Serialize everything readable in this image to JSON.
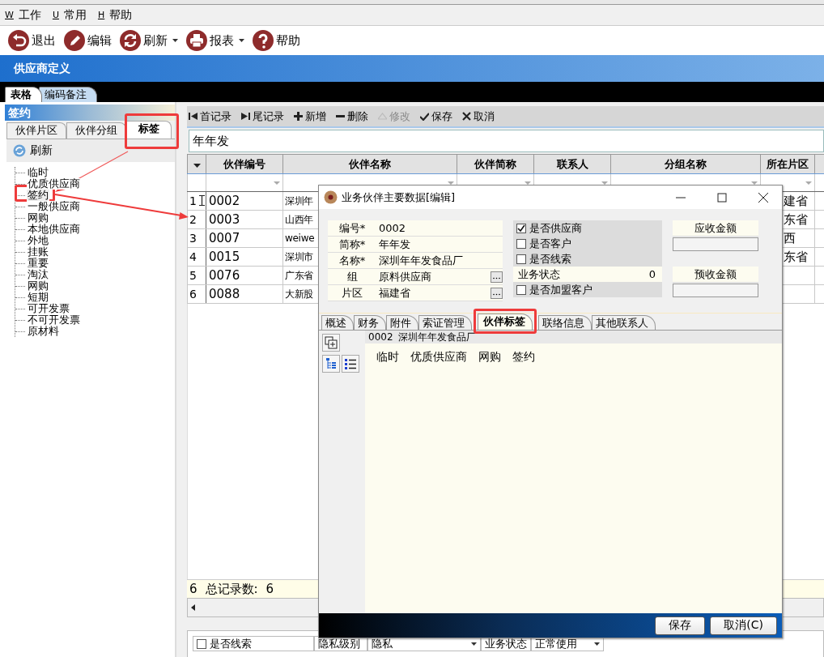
{
  "menu": [
    {
      "key": "W",
      "label": "工作"
    },
    {
      "key": "U",
      "label": "常用"
    },
    {
      "key": "H",
      "label": "帮助"
    }
  ],
  "toolbar": [
    {
      "kind": "exit",
      "label": "退出",
      "dropdown": false
    },
    {
      "kind": "edit",
      "label": "编辑",
      "dropdown": false
    },
    {
      "kind": "refresh",
      "label": "刷新",
      "dropdown": true
    },
    {
      "kind": "print",
      "label": "报表",
      "dropdown": true
    },
    {
      "kind": "help",
      "label": "帮助",
      "dropdown": false
    }
  ],
  "app_title": "供应商定义",
  "view_tabs": [
    {
      "label": "表格",
      "selected": true
    },
    {
      "label": "编码备注",
      "selected": false
    }
  ],
  "left_panel": {
    "title": "签约",
    "tabs": [
      {
        "label": "伙伴片区",
        "selected": false
      },
      {
        "label": "伙伴分组",
        "selected": false
      },
      {
        "label": "标签",
        "selected": true
      }
    ],
    "refresh": "刷新",
    "tree": [
      {
        "label": "临时",
        "selected": false
      },
      {
        "label": "优质供应商",
        "selected": false
      },
      {
        "label": "签约",
        "selected": true
      },
      {
        "label": "一般供应商",
        "selected": false
      },
      {
        "label": "网购",
        "selected": false
      },
      {
        "label": "本地供应商",
        "selected": false
      },
      {
        "label": "外地",
        "selected": false
      },
      {
        "label": "挂账",
        "selected": false
      },
      {
        "label": "重要",
        "selected": false
      },
      {
        "label": "淘汰",
        "selected": false
      },
      {
        "label": "网购",
        "selected": false
      },
      {
        "label": "短期",
        "selected": false
      },
      {
        "label": "可开发票",
        "selected": false
      },
      {
        "label": "不可开发票",
        "selected": false
      },
      {
        "label": "原材料",
        "selected": false
      }
    ]
  },
  "grid_toolbar": [
    {
      "kind": "first",
      "label": "首记录",
      "disabled": false
    },
    {
      "kind": "last",
      "label": "尾记录",
      "disabled": false
    },
    {
      "kind": "add",
      "label": "新增",
      "disabled": false
    },
    {
      "kind": "delete",
      "label": "删除",
      "disabled": false
    },
    {
      "kind": "modify",
      "label": "修改",
      "disabled": true
    },
    {
      "kind": "save",
      "label": "保存",
      "disabled": false
    },
    {
      "kind": "cancel",
      "label": "取消",
      "disabled": false
    }
  ],
  "search": {
    "value": "年年发"
  },
  "table": {
    "columns": [
      "伙伴编号",
      "伙伴名称",
      "伙伴简称",
      "联系人",
      "分组名称",
      "所在片区"
    ],
    "rows": [
      {
        "number": "1",
        "current": true,
        "code": "0002",
        "name": "深圳年",
        "region": "建省"
      },
      {
        "number": "2",
        "current": false,
        "code": "0003",
        "name": "山西年",
        "region": "东省"
      },
      {
        "number": "3",
        "current": false,
        "code": "0007",
        "name": "weiwe",
        "region": "西"
      },
      {
        "number": "4",
        "current": false,
        "code": "0015",
        "name": "深圳市",
        "region": "东省"
      },
      {
        "number": "5",
        "current": false,
        "code": "0076",
        "name": "广东省"
      },
      {
        "number": "6",
        "current": false,
        "code": "0088",
        "name": "大新股"
      }
    ],
    "footer": {
      "count": "6",
      "label": "总记录数:",
      "total": "6"
    }
  },
  "bottom_form": [
    {
      "kind": "checkbox",
      "label": "是否线索",
      "checked": false
    },
    {
      "kind": "label",
      "label": "隐私级别"
    },
    {
      "kind": "select",
      "value": "隐私"
    },
    {
      "kind": "label",
      "label": "业务状态"
    },
    {
      "kind": "select",
      "value": "正常使用"
    }
  ],
  "dialog": {
    "title": "业务伙伴主要数据[编辑]",
    "fields": [
      {
        "label": "编号*",
        "value": "0002",
        "picker": false
      },
      {
        "label": "简称*",
        "value": "年年发",
        "picker": false
      },
      {
        "label": "名称*",
        "value": "深圳年年发食品厂",
        "picker": false
      },
      {
        "label": "组",
        "value": "原料供应商",
        "picker": true
      },
      {
        "label": "片区",
        "value": "福建省",
        "picker": true
      }
    ],
    "flags": [
      {
        "kind": "checkbox",
        "label": "是否供应商",
        "checked": true
      },
      {
        "kind": "checkbox",
        "label": "是否客户",
        "checked": false
      },
      {
        "kind": "checkbox",
        "label": "是否线索",
        "checked": false
      },
      {
        "kind": "value",
        "label": "业务状态",
        "value": "0"
      },
      {
        "kind": "checkbox",
        "label": "是否加盟客户",
        "checked": false
      }
    ],
    "amounts": [
      {
        "label": "应收金额"
      },
      {
        "label": "预收金额"
      }
    ],
    "tabs": [
      {
        "label": "概述",
        "selected": false
      },
      {
        "label": "财务",
        "selected": false
      },
      {
        "label": "附件",
        "selected": false
      },
      {
        "label": "索证管理",
        "selected": false
      },
      {
        "label": "伙伴标签",
        "selected": true
      },
      {
        "label": "联络信息",
        "selected": false
      },
      {
        "label": "其他联系人",
        "selected": false
      }
    ],
    "tag_header": {
      "code": "0002",
      "name": "深圳年年发食品厂"
    },
    "tags": [
      "临时",
      "优质供应商",
      "网购",
      "签约"
    ],
    "buttons": [
      "保存",
      "取消(C)"
    ]
  }
}
